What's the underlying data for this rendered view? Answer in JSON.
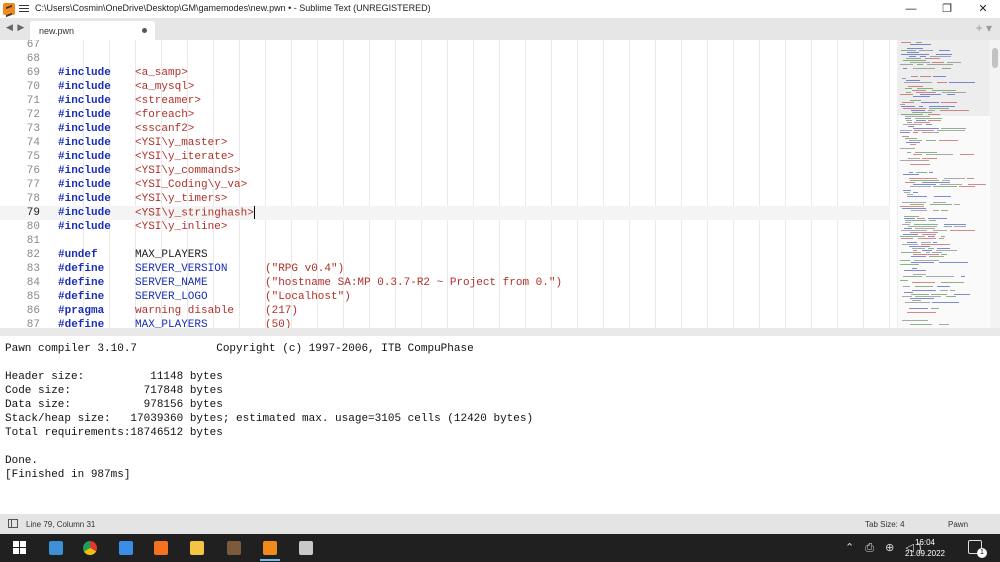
{
  "window": {
    "title": "C:\\Users\\Cosmin\\OneDrive\\Desktop\\GM\\gamemodes\\new.pwn • - Sublime Text (UNREGISTERED)",
    "minimize": "—",
    "maximize": "❐",
    "close": "✕"
  },
  "tabbar": {
    "nav": "◀ ▶",
    "active_tab": "new.pwn",
    "add_tab": "+",
    "tab_menu": "▾"
  },
  "editor": {
    "lines": [
      {
        "n": "67",
        "kw": "",
        "arg": "",
        "str": "",
        "kind": ""
      },
      {
        "n": "68",
        "kw": "",
        "arg": "",
        "str": "",
        "kind": ""
      },
      {
        "n": "69",
        "kw": "#include",
        "arg": "<a_samp>",
        "str": "",
        "kind": "inc"
      },
      {
        "n": "70",
        "kw": "#include",
        "arg": "<a_mysql>",
        "str": "",
        "kind": "inc"
      },
      {
        "n": "71",
        "kw": "#include",
        "arg": "<streamer>",
        "str": "",
        "kind": "inc"
      },
      {
        "n": "72",
        "kw": "#include",
        "arg": "<foreach>",
        "str": "",
        "kind": "inc"
      },
      {
        "n": "73",
        "kw": "#include",
        "arg": "<sscanf2>",
        "str": "",
        "kind": "inc"
      },
      {
        "n": "74",
        "kw": "#include",
        "arg": "<YSI\\y_master>",
        "str": "",
        "kind": "inc"
      },
      {
        "n": "75",
        "kw": "#include",
        "arg": "<YSI\\y_iterate>",
        "str": "",
        "kind": "inc"
      },
      {
        "n": "76",
        "kw": "#include",
        "arg": "<YSI\\y_commands>",
        "str": "",
        "kind": "inc"
      },
      {
        "n": "77",
        "kw": "#include",
        "arg": "<YSI_Coding\\y_va>",
        "str": "",
        "kind": "inc"
      },
      {
        "n": "78",
        "kw": "#include",
        "arg": "<YSI\\y_timers>",
        "str": "",
        "kind": "inc"
      },
      {
        "n": "79",
        "kw": "#include",
        "arg": "<YSI\\y_stringhash>",
        "str": "",
        "kind": "inc"
      },
      {
        "n": "80",
        "kw": "#include",
        "arg": "<YSI\\y_inline>",
        "str": "",
        "kind": "inc"
      },
      {
        "n": "81",
        "kw": "",
        "arg": "",
        "str": "",
        "kind": ""
      },
      {
        "n": "82",
        "kw": "#undef",
        "arg": "MAX_PLAYERS",
        "str": "",
        "kind": "plain"
      },
      {
        "n": "83",
        "kw": "#define",
        "arg": "SERVER_VERSION",
        "str": "(\"RPG v0.4\")",
        "kind": "blue"
      },
      {
        "n": "84",
        "kw": "#define",
        "arg": "SERVER_NAME",
        "str": "(\"hostname SA:MP 0.3.7-R2 ~ Project from 0.\")",
        "kind": "blue"
      },
      {
        "n": "85",
        "kw": "#define",
        "arg": "SERVER_LOGO",
        "str": "(\"Localhost\")",
        "kind": "blue"
      },
      {
        "n": "86",
        "kw": "#pragma",
        "arg": "warning disable",
        "str": "(217)",
        "kind": "inc"
      },
      {
        "n": "87",
        "kw": "#define",
        "arg": "MAX_PLAYERS",
        "str": "(50)",
        "kind": "blue"
      }
    ],
    "current_line": "79"
  },
  "output": {
    "lines": [
      "Pawn compiler 3.10.7            Copyright (c) 1997-2006, ITB CompuPhase",
      "",
      "Header size:          11148 bytes",
      "Code size:           717848 bytes",
      "Data size:           978156 bytes",
      "Stack/heap size:   17039360 bytes; estimated max. usage=3105 cells (12420 bytes)",
      "Total requirements:18746512 bytes",
      "",
      "Done.",
      "[Finished in 987ms]"
    ]
  },
  "statusbar": {
    "position": "Line 79, Column 31",
    "tab_size": "Tab Size: 4",
    "syntax": "Pawn"
  },
  "taskbar": {
    "apps": [
      {
        "name": "start-button",
        "color": "#ffffff"
      },
      {
        "name": "file-explorer-alt-icon",
        "color": "#3d8fd8"
      },
      {
        "name": "chrome-icon",
        "color": "#e0392b"
      },
      {
        "name": "store-icon",
        "color": "#3a8ee6"
      },
      {
        "name": "xampp-icon",
        "color": "#f37321"
      },
      {
        "name": "file-explorer-icon",
        "color": "#f4c542"
      },
      {
        "name": "game-icon",
        "color": "#7a5a3a"
      },
      {
        "name": "sublime-text-icon",
        "color": "#f28a1b"
      },
      {
        "name": "samp-icon",
        "color": "#c9c9c9"
      }
    ],
    "tray": "⌃ ⎙ ⊕ ◁)",
    "time": "16:04",
    "date": "21.09.2022",
    "notifications": "1"
  }
}
